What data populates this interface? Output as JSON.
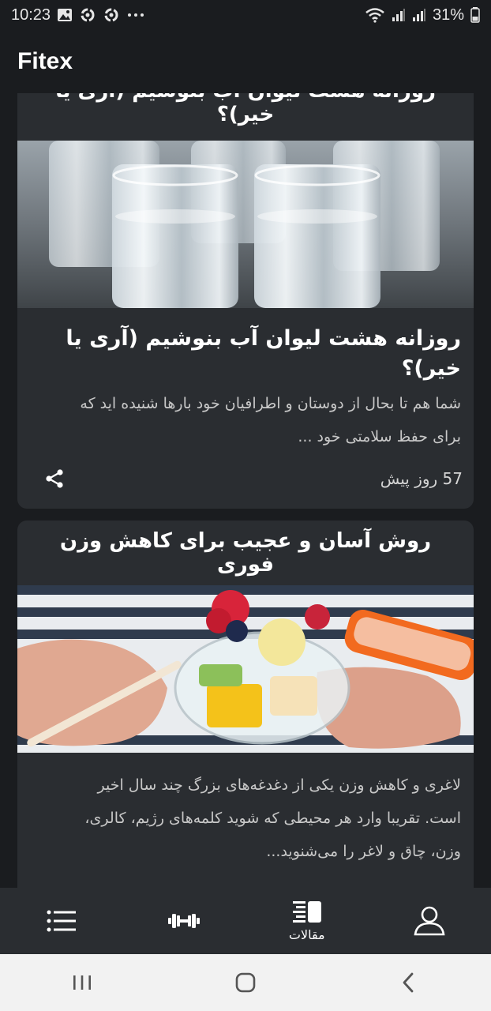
{
  "status_bar": {
    "time": "10:23",
    "battery": "31%",
    "icons": [
      "gallery-icon",
      "sync-icon",
      "sync-icon",
      "more-dots-icon",
      "wifi-icon",
      "signal-icon",
      "signal-icon",
      "battery-icon"
    ]
  },
  "app_bar": {
    "title": "Fitex"
  },
  "articles": [
    {
      "header_title": "روزانه هشت لیوان آب بنوشیم (آری یا خیر)؟",
      "title": "روزانه هشت لیوان آب بنوشیم (آری یا خیر)؟",
      "summary_line1": "شما هم تا بحال از دوستان و اطرافیان خود بارها شنیده اید که",
      "summary_line2": "برای حفظ سلامتی خود ...",
      "date": "57 روز پیش",
      "image": "water-glasses-image"
    },
    {
      "header_title": "روش آسان و عجیب برای کاهش وزن فوری",
      "summary_line1": "لاغری و کاهش وزن یکی از دغدغه‌های بزرگ چند سال اخیر",
      "summary_line2": "است. تقریبا وارد هر محیطی که شوید کلمه‌های رژیم، کالری،",
      "summary_line3": "وزن، چاق و لاغر را می‌شنوید...",
      "image": "fruit-salad-jar-image"
    }
  ],
  "bottom_nav": {
    "items": [
      {
        "icon": "list-icon",
        "label": ""
      },
      {
        "icon": "dumbbell-icon",
        "label": ""
      },
      {
        "icon": "articles-icon",
        "label": "مقالات"
      },
      {
        "icon": "profile-icon",
        "label": ""
      }
    ]
  },
  "system_nav": {
    "icons": [
      "recents-icon",
      "home-icon",
      "back-icon"
    ]
  },
  "colors": {
    "background": "#1a1c1f",
    "card": "#2a2d31",
    "text_primary": "#ffffff",
    "text_secondary": "#c8c8c8",
    "system_nav": "#f2f2f2"
  }
}
